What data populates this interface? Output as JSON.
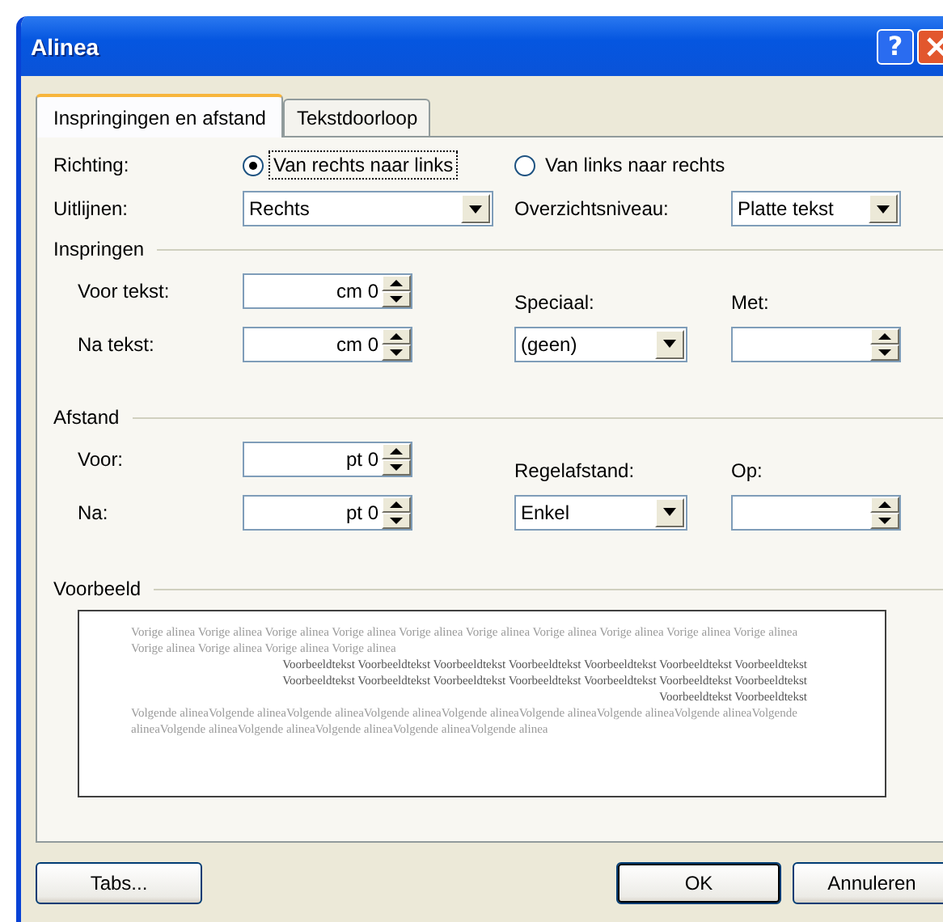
{
  "window": {
    "title": "Alinea",
    "help_button": "?"
  },
  "tabs": [
    {
      "label": "Inspringingen en afstand",
      "selected": true
    },
    {
      "label": "Tekstdoorloop",
      "selected": false
    }
  ],
  "direction": {
    "label": "Richting:",
    "options": [
      {
        "label": "Van rechts naar links",
        "selected": true,
        "focused": true
      },
      {
        "label": "Van links naar rechts",
        "selected": false,
        "focused": false
      }
    ]
  },
  "alignment": {
    "label": "Uitlijnen:",
    "value": "Rechts"
  },
  "outline_level": {
    "label": "Overzichtsniveau:",
    "value": "Platte tekst"
  },
  "indentation": {
    "title": "Inspringen",
    "fields": [
      {
        "label": "Voor tekst:",
        "value": "cm 0"
      },
      {
        "label": "Na tekst:",
        "value": "cm 0"
      }
    ],
    "special": {
      "label": "Speciaal:",
      "value": "(geen)"
    },
    "by": {
      "label": "Met:"
    }
  },
  "spacing": {
    "title": "Afstand",
    "fields": [
      {
        "label": "Voor:",
        "value": "pt 0"
      },
      {
        "label": "Na:",
        "value": "pt 0"
      }
    ],
    "line_spacing": {
      "label": "Regelafstand:",
      "value": "Enkel"
    },
    "at": {
      "label": "Op:"
    }
  },
  "preview": {
    "title": "Voorbeeld",
    "previous_text": "Vorige alinea Vorige alinea Vorige alinea Vorige alinea Vorige alinea Vorige alinea Vorige alinea Vorige alinea Vorige alinea Vorige alinea Vorige alinea Vorige alinea Vorige alinea Vorige alinea",
    "sample_text": "Voorbeeldtekst Voorbeeldtekst Voorbeeldtekst Voorbeeldtekst Voorbeeldtekst Voorbeeldtekst Voorbeeldtekst Voorbeeldtekst Voorbeeldtekst Voorbeeldtekst Voorbeeldtekst Voorbeeldtekst Voorbeeldtekst Voorbeeldtekst Voorbeeldtekst Voorbeeldtekst",
    "following_text": "Volgende alineaVolgende alineaVolgende alineaVolgende alineaVolgende alineaVolgende alineaVolgende alineaVolgende alineaVolgende alineaVolgende alineaVolgende alineaVolgende alineaVolgende alineaVolgende alinea"
  },
  "buttons": [
    {
      "label": "Tabs...",
      "default": false
    },
    {
      "label": "OK",
      "default": true
    },
    {
      "label": "Annuleren",
      "default": false
    }
  ]
}
